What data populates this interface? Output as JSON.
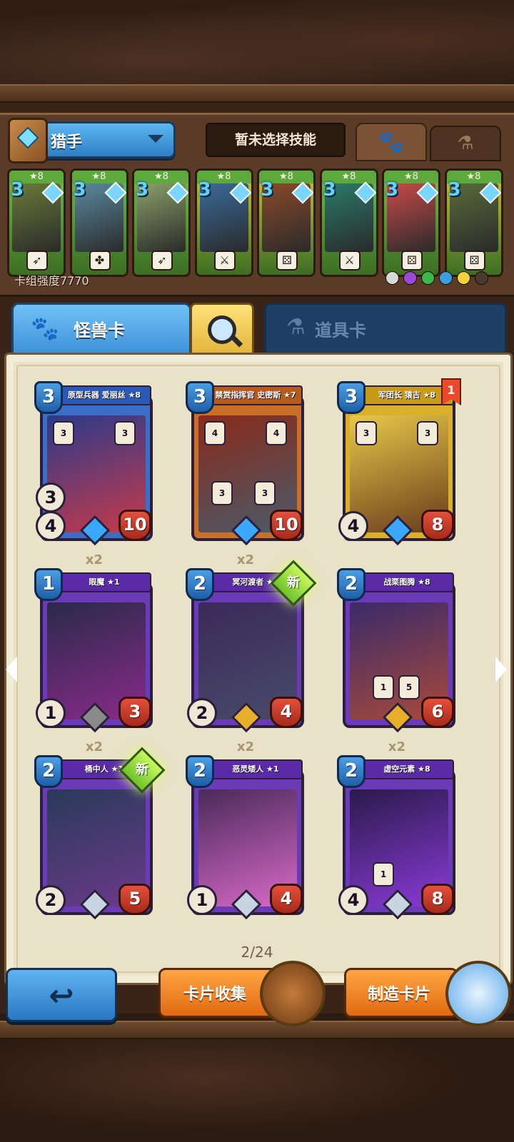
{
  "header": {
    "class_name": "猎手",
    "skill_text": "暂未选择技能"
  },
  "deck": {
    "strength_label": "卡组强度7770",
    "cards": [
      {
        "stars": "★8",
        "cost": "3",
        "bottom": "bow-icon",
        "color": "#6ec04a"
      },
      {
        "stars": "★8",
        "cost": "3",
        "bottom": "clover-icon",
        "color": "#6ec04a"
      },
      {
        "stars": "★8",
        "cost": "3",
        "bottom": "bow-icon",
        "color": "#6ec04a"
      },
      {
        "stars": "★8",
        "cost": "3",
        "bottom": "sword-icon",
        "color": "#c8c43a"
      },
      {
        "stars": "★8",
        "cost": "3",
        "bottom": "dice-icon",
        "color": "#c8c43a"
      },
      {
        "stars": "★8",
        "cost": "3",
        "bottom": "sword-icon",
        "color": "#6ec04a"
      },
      {
        "stars": "★8",
        "cost": "3",
        "bottom": "dice-icon",
        "color": "#6ec04a"
      },
      {
        "stars": "★8",
        "cost": "3",
        "bottom": "dice-icon",
        "color": "#c8c43a"
      }
    ],
    "element_colors": [
      "#d8d8d8",
      "#9b4ad8",
      "#3ab84a",
      "#3a9fe0",
      "#f2d23a",
      "#4a3a30"
    ]
  },
  "tabs": {
    "monster": "怪兽卡",
    "item": "道具卡"
  },
  "cards": [
    {
      "name": "原型兵器 爱丽丝 ★8",
      "cost": "3",
      "atk": "4",
      "hp": "10",
      "extra": "3",
      "skills": [
        "3",
        "3"
      ],
      "frame": "blue",
      "copies": "",
      "new": false,
      "flag": "",
      "rarity": "#3aa8ff"
    },
    {
      "name": "禁赏指挥官 史密斯 ★7",
      "cost": "3",
      "atk": "",
      "hp": "10",
      "extra": "",
      "skills": [
        "4",
        "4",
        "3",
        "3"
      ],
      "frame": "orange",
      "copies": "",
      "new": false,
      "flag": "",
      "rarity": "#3aa8ff"
    },
    {
      "name": "军团长 猿吉 ★8",
      "cost": "3",
      "atk": "4",
      "hp": "8",
      "extra": "",
      "skills": [
        "3",
        "3"
      ],
      "frame": "gold",
      "copies": "",
      "new": false,
      "flag": "1",
      "rarity": "#3aa8ff"
    },
    {
      "name": "眼魔 ★1",
      "cost": "1",
      "atk": "1",
      "hp": "3",
      "extra": "",
      "skills": [],
      "frame": "purple",
      "copies": "x2",
      "new": false,
      "flag": "",
      "rarity": "#8a8a8a"
    },
    {
      "name": "冥河渡者 ★1",
      "cost": "2",
      "atk": "2",
      "hp": "4",
      "extra": "",
      "skills": [],
      "frame": "purple",
      "copies": "x2",
      "new": true,
      "flag": "",
      "rarity": "#e8b02a"
    },
    {
      "name": "战栗图腾 ★8",
      "cost": "2",
      "atk": "",
      "hp": "6",
      "extra": "",
      "skills": [
        "1",
        "5"
      ],
      "frame": "purple",
      "copies": "",
      "new": false,
      "flag": "",
      "rarity": "#e8b02a"
    },
    {
      "name": "桶中人 ★1",
      "cost": "2",
      "atk": "2",
      "hp": "5",
      "extra": "",
      "skills": [],
      "frame": "purple",
      "copies": "x2",
      "new": true,
      "flag": "",
      "rarity": "#c8d4e0"
    },
    {
      "name": "恶灵矮人 ★1",
      "cost": "2",
      "atk": "1",
      "hp": "4",
      "extra": "",
      "skills": [],
      "frame": "purple",
      "copies": "x2",
      "new": false,
      "flag": "",
      "rarity": "#c8d4e0"
    },
    {
      "name": "虚空元素 ★8",
      "cost": "2",
      "atk": "4",
      "hp": "8",
      "extra": "",
      "skills": [
        "1"
      ],
      "frame": "purple",
      "copies": "x2",
      "new": false,
      "flag": "",
      "rarity": "#c8d4e0"
    }
  ],
  "new_label": "新",
  "page_indicator": "2/24",
  "buttons": {
    "collection": "卡片收集",
    "craft": "制造卡片"
  }
}
